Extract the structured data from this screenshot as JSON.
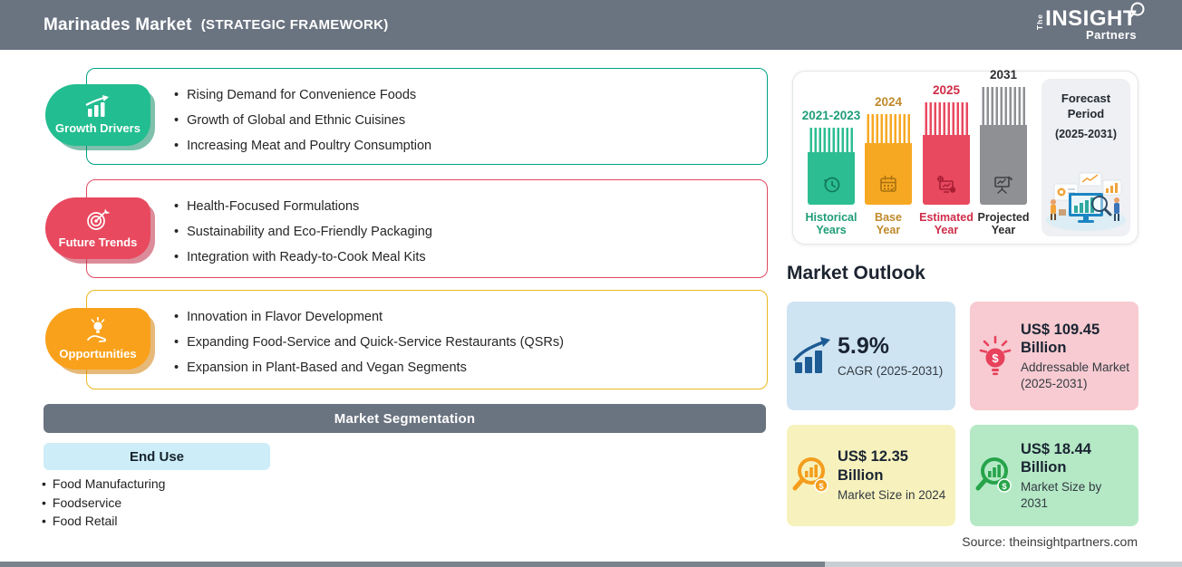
{
  "header": {
    "title": "Marinades Market",
    "subtitle": "(STRATEGIC FRAMEWORK)",
    "logo": {
      "the": "The",
      "insight": "INSIGHT",
      "partners": "Partners"
    }
  },
  "growth_drivers": {
    "label": "Growth Drivers",
    "color": "#22BD90",
    "border_color": "#00A184",
    "items": [
      "Rising Demand for Convenience Foods",
      "Growth of Global and Ethnic Cuisines",
      "Increasing Meat and Poultry Consumption"
    ]
  },
  "future_trends": {
    "label": "Future Trends",
    "color": "#E8495E",
    "border_color": "#E04A5F",
    "items": [
      "Health-Focused Formulations",
      "Sustainability and Eco-Friendly Packaging",
      "Integration with Ready-to-Cook Meal Kits"
    ]
  },
  "opportunities": {
    "label": "Opportunities",
    "color": "#F9A11B",
    "border_color": "#EAB81F",
    "items": [
      "Innovation in Flavor Development",
      "Expanding Food-Service and Quick-Service Restaurants (QSRs)",
      "Expansion in Plant-Based and Vegan Segments"
    ]
  },
  "segmentation": {
    "title": "Market Segmentation",
    "category": "End Use",
    "items": [
      "Food Manufacturing",
      "Foodservice",
      "Food Retail"
    ]
  },
  "timeline": {
    "bars": [
      {
        "year": "2021-2023",
        "label": "Historical\nYears",
        "color": "#2DBD92",
        "icon": "history-clock-icon"
      },
      {
        "year": "2024",
        "label": "Base\nYear",
        "color": "#F7A823",
        "icon": "calendar-icon"
      },
      {
        "year": "2025",
        "label": "Estimated\nYear",
        "color": "#E8495F",
        "icon": "monitor-analysis-icon"
      },
      {
        "year": "2031",
        "label": "Projected\nYear",
        "color": "#8F9094",
        "icon": "projection-screen-icon"
      }
    ],
    "forecast_title": "Forecast\nPeriod",
    "forecast_range": "(2025-2031)"
  },
  "outlook": {
    "title": "Market Outlook",
    "cards": [
      {
        "value": "5.9%",
        "desc": "CAGR (2025-2031)",
        "bg": "#CFE4F2",
        "icon": "bar-growth-icon"
      },
      {
        "value": "US$ 109.45 Billion",
        "desc": "Addressable Market (2025-2031)",
        "bg": "#F7CBD1",
        "icon": "bulb-dollar-icon"
      },
      {
        "value": "US$ 12.35 Billion",
        "desc": "Market Size in 2024",
        "bg": "#F7F2BD",
        "icon": "magnifier-chart-icon"
      },
      {
        "value": "US$ 18.44 Billion",
        "desc": "Market Size by 2031",
        "bg": "#B5E9C6",
        "icon": "magnifier-chart-icon"
      }
    ]
  },
  "source": "Source: theinsightpartners.com"
}
